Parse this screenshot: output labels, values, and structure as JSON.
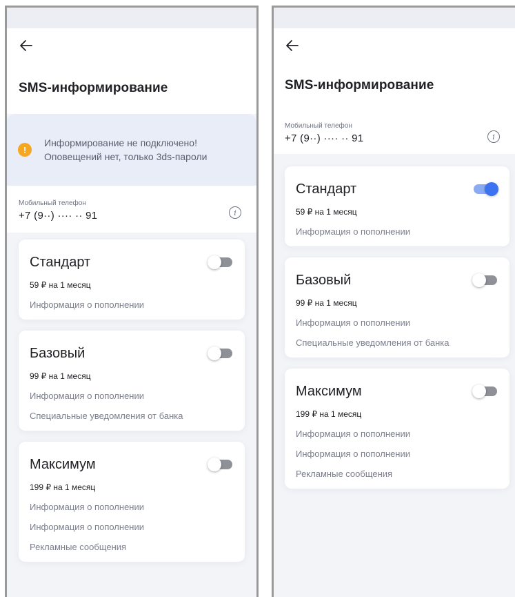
{
  "left": {
    "title": "SMS-информирование",
    "warning": {
      "line1": "Информирование не подключено!",
      "line2": "Оповещений нет, только 3ds-пароли"
    },
    "phone": {
      "label": "Мобильный телефон",
      "value": "+7 (9··) ···· ·· 91"
    },
    "plans": [
      {
        "name": "Стандарт",
        "price": "59 ₽ на 1 месяц",
        "features": [
          "Информация о пополнении"
        ],
        "enabled": false
      },
      {
        "name": "Базовый",
        "price": "99 ₽ на 1 месяц",
        "features": [
          "Информация о пополнении",
          "Специальные уведомления от банка"
        ],
        "enabled": false
      },
      {
        "name": "Максимум",
        "price": "199 ₽ на 1 месяц",
        "features": [
          "Информация о пополнении",
          "Информация о пополнении",
          "Рекламные сообщения"
        ],
        "enabled": false
      }
    ]
  },
  "right": {
    "title": "SMS-информирование",
    "phone": {
      "label": "Мобильный телефон",
      "value": "+7 (9··) ···· ·· 91"
    },
    "plans": [
      {
        "name": "Стандарт",
        "price": "59 ₽ на 1 месяц",
        "features": [
          "Информация о пополнении"
        ],
        "enabled": true
      },
      {
        "name": "Базовый",
        "price": "99 ₽ на 1 месяц",
        "features": [
          "Информация о пополнении",
          "Специальные уведомления от банка"
        ],
        "enabled": false
      },
      {
        "name": "Максимум",
        "price": "199 ₽ на 1 месяц",
        "features": [
          "Информация о пополнении",
          "Информация о пополнении",
          "Рекламные сообщения"
        ],
        "enabled": false
      }
    ]
  },
  "colors": {
    "accent": "#3d73f0",
    "warning": "#f5a623",
    "banner_bg": "#e8edf7",
    "page_bg": "#f3f4f8"
  },
  "icons": {
    "back": "arrow-left-icon",
    "info": "info-icon",
    "warning": "exclamation-icon"
  }
}
